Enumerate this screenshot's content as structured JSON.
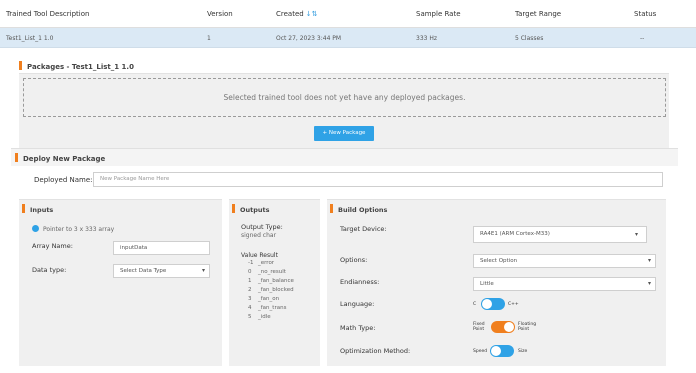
{
  "table": {
    "columns": {
      "description": "Trained Tool Description",
      "version": "Version",
      "created": "Created",
      "sample_rate": "Sample Rate",
      "target_range": "Target Range",
      "status": "Status"
    },
    "sort_indicator": "↓⇅",
    "row": {
      "description": "Test1_List_1 1.0",
      "version": "1",
      "created": "Oct 27, 2023 3:44 PM",
      "sample_rate": "333 Hz",
      "target_range": "5 Classes",
      "status": "--"
    }
  },
  "packages": {
    "title": "Packages - Test1_List_1 1.0",
    "empty_message": "Selected trained tool does not yet have any deployed packages.",
    "new_button": "+ New Package"
  },
  "deploy": {
    "title": "Deploy New Package",
    "name_label": "Deployed Name:",
    "name_placeholder": "New Package Name Here"
  },
  "inputs": {
    "title": "Inputs",
    "hint": "Pointer to 3 x 333 array",
    "array_name_label": "Array Name:",
    "array_name_value": "inputData",
    "data_type_label": "Data type:",
    "data_type_value": "Select Data Type"
  },
  "outputs": {
    "title": "Outputs",
    "output_type_label": "Output Type:",
    "output_type_value": "signed char",
    "value_header": "Value",
    "result_header": "Result",
    "rows": [
      {
        "value": "-1",
        "result": "_error"
      },
      {
        "value": "0",
        "result": "_no_result"
      },
      {
        "value": "1",
        "result": "_fan_balance"
      },
      {
        "value": "2",
        "result": "_fan_blocked"
      },
      {
        "value": "3",
        "result": "_fan_on"
      },
      {
        "value": "4",
        "result": "_fan_trans"
      },
      {
        "value": "5",
        "result": "_idle"
      }
    ]
  },
  "build": {
    "title": "Build Options",
    "target_device_label": "Target Device:",
    "target_device_value": "RA4E1 (ARM Cortex-M33)",
    "options_label": "Options:",
    "options_value": "Select Option",
    "endianness_label": "Endianness:",
    "endianness_value": "Little",
    "language_label": "Language:",
    "language_left": "C",
    "language_right": "C++",
    "math_type_label": "Math Type:",
    "math_left": "Fixed Point",
    "math_right": "Floating Point",
    "optimization_label": "Optimization Method:",
    "opt_left": "Speed",
    "opt_right": "Size"
  },
  "colors": {
    "accent_blue": "#2fa2e6",
    "accent_orange": "#f07f1e",
    "row_highlight": "#dbe9f5"
  },
  "icons": {
    "sort": "sort-icon",
    "info": "info-icon",
    "dropdown": "chevron-down-icon"
  }
}
